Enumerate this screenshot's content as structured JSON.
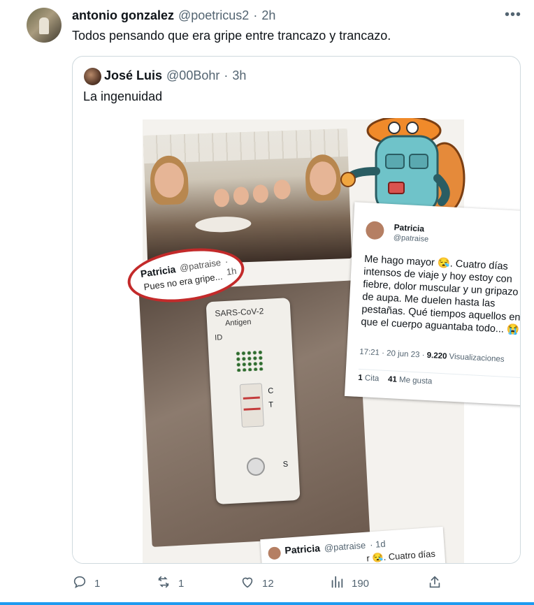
{
  "tweet": {
    "author_name": "antonio gonzalez",
    "author_handle": "@poetricus2",
    "separator": "·",
    "time": "2h",
    "more_icon": "more-icon",
    "text": "Todos pensando que era gripe entre trancazo y trancazo."
  },
  "quote": {
    "author_name": "José Luis",
    "author_handle": "@00Bohr",
    "separator": "·",
    "time": "3h",
    "text": "La ingenuidad",
    "media": {
      "circled_post": {
        "name": "Patricia",
        "handle": "@patraise",
        "time": "· 1h",
        "text": "Pues no era gripe..."
      },
      "test_labels": {
        "brand": "SARS-CoV-2",
        "type": "Antigen",
        "id": "ID",
        "c": "C",
        "t": "T",
        "s": "S"
      },
      "card": {
        "name": "Patricia",
        "handle": "@patraise",
        "text": "Me hago mayor 😪. Cuatro días\nintensos de viaje y hoy estoy con\nfiebre, dolor muscular y un gripazo\nde aupa. Me duelen hasta las\npestañas. Qué tiempos aquellos en\nque el cuerpo aguantaba todo... 😭",
        "meta_time": "17:21 · 20 jun 23 ·",
        "meta_views": "9.220",
        "meta_views_label": "Visualizaciones",
        "quotes_count": "1",
        "quotes_label": "Cita",
        "likes_count": "41",
        "likes_label": "Me gusta"
      },
      "bottom_card": {
        "name": "Patricia",
        "handle": "@patraise",
        "time": "· 1d",
        "text": "r 😪. Cuatro días"
      }
    }
  },
  "actions": {
    "reply_icon": "reply-icon",
    "reply_count": "1",
    "retweet_icon": "retweet-icon",
    "retweet_count": "1",
    "like_icon": "like-icon",
    "like_count": "12",
    "views_icon": "views-icon",
    "views_count": "190",
    "share_icon": "share-icon"
  },
  "colors": {
    "accent": "#1d9bf0",
    "text": "#0f1419",
    "muted": "#536471",
    "border": "#cfd9de",
    "circle_red": "#c32a2a"
  }
}
